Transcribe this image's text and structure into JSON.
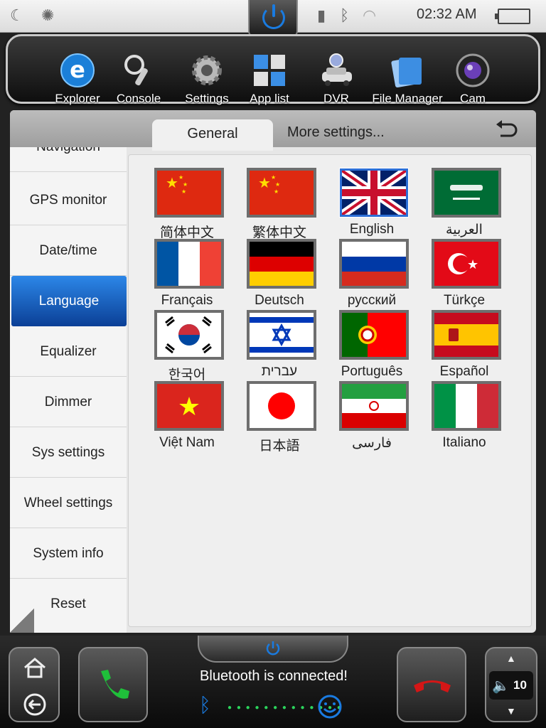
{
  "statusbar": {
    "time": "02:32 AM",
    "icons": [
      "moon-icon",
      "brightness-icon",
      "usb-icon",
      "bluetooth-icon",
      "wifi-icon",
      "battery-icon"
    ]
  },
  "dock": {
    "apps": [
      {
        "label": "Explorer",
        "icon": "explorer-icon"
      },
      {
        "label": "Console",
        "icon": "steering-wheel-icon"
      },
      {
        "label": "Settings",
        "icon": "gear-icon"
      },
      {
        "label": "App list",
        "icon": "app-grid-icon"
      },
      {
        "label": "DVR",
        "icon": "dvr-car-icon"
      },
      {
        "label": "File Manager",
        "icon": "folder-icon"
      },
      {
        "label": "Cam",
        "icon": "camera-icon"
      }
    ]
  },
  "tabs": {
    "general": "General",
    "more": "More settings..."
  },
  "sidebar": {
    "items": [
      {
        "label": "Navigation"
      },
      {
        "label": "GPS monitor"
      },
      {
        "label": "Date/time"
      },
      {
        "label": "Language",
        "active": true
      },
      {
        "label": "Equalizer"
      },
      {
        "label": "Dimmer"
      },
      {
        "label": "Sys settings"
      },
      {
        "label": "Wheel settings"
      },
      {
        "label": "System info"
      },
      {
        "label": "Reset"
      }
    ]
  },
  "languages": [
    {
      "label": "简体中文",
      "flag": "cn"
    },
    {
      "label": "繁体中文",
      "flag": "cn"
    },
    {
      "label": "English",
      "flag": "uk",
      "selected": true
    },
    {
      "label": "العربية",
      "flag": "sa"
    },
    {
      "label": "Français",
      "flag": "fr"
    },
    {
      "label": "Deutsch",
      "flag": "de"
    },
    {
      "label": "русский",
      "flag": "ru"
    },
    {
      "label": "Türkçe",
      "flag": "tr"
    },
    {
      "label": "한국어",
      "flag": "kr"
    },
    {
      "label": "עברית",
      "flag": "il"
    },
    {
      "label": "Português",
      "flag": "pt"
    },
    {
      "label": "Español",
      "flag": "es"
    },
    {
      "label": "Việt Nam",
      "flag": "vn"
    },
    {
      "label": "日本語",
      "flag": "jp"
    },
    {
      "label": "فارسی",
      "flag": "ir"
    },
    {
      "label": "Italiano",
      "flag": "it"
    }
  ],
  "bottom": {
    "bt_status": "Bluetooth is connected!",
    "volume": "10"
  },
  "colors": {
    "accent": "#1a7be0",
    "active_tab": "#0b3f96",
    "call_green": "#1fbf3a",
    "call_red": "#d41616"
  }
}
